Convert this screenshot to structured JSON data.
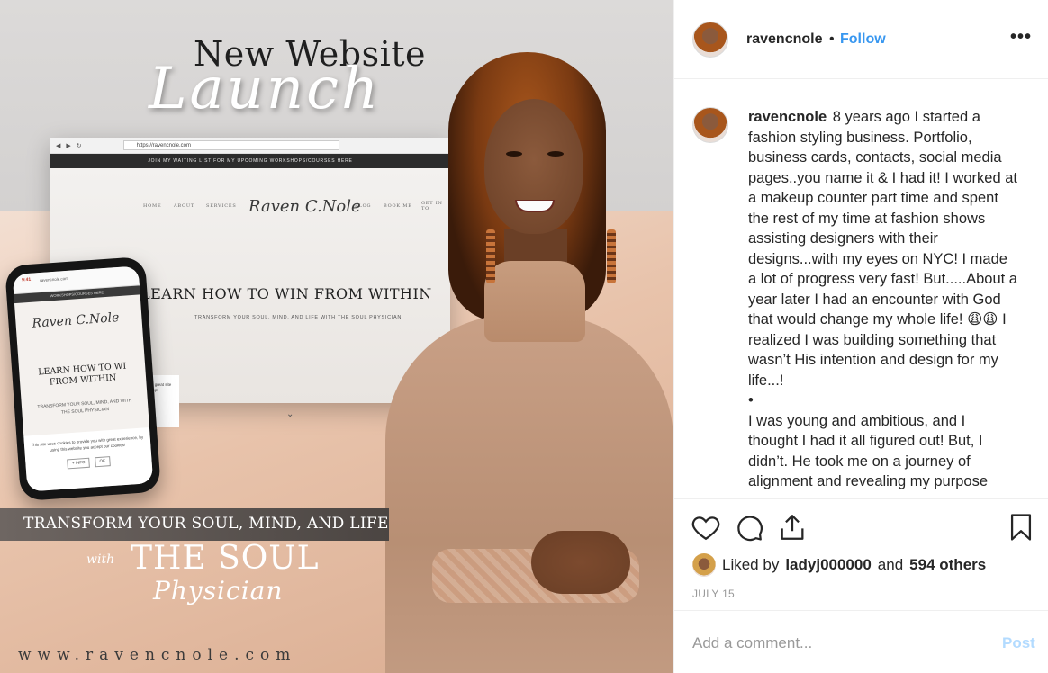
{
  "image": {
    "headline": "New Website",
    "script_word": "Launch",
    "browser": {
      "url": "https://ravencnole.com",
      "banner": "JOIN MY WAITING LIST FOR MY UPCOMING WORKSHOPS/COURSES HERE",
      "nav": [
        "HOME",
        "ABOUT",
        "SERVICES",
        "BLOG",
        "BOOK ME",
        "GET IN TO"
      ],
      "logo": "Raven C.Nole",
      "hero": "LEARN HOW TO WIN FROM WITHIN",
      "sub": "TRANSFORM YOUR SOUL, MIND, AND LIFE WITH THE SOUL PHYSICIAN",
      "cookie": "you with great site you accept",
      "arrow": "⌄"
    },
    "phone": {
      "time": "9:41",
      "url": "ravencnole.com",
      "banner": "WORKSHOPS/COURSES HERE",
      "logo": "Raven C.Nole",
      "hero": "LEARN HOW TO WI FROM WITHIN",
      "sub": "TRANSFORM YOUR SOUL, MIND, AND WITH THE SOUL PHYSICIAN",
      "cookie": "This site uses cookies to provide you with great experience, by using this website you accept our cookies!",
      "btn_info": "+ INFO",
      "btn_ok": "OK"
    },
    "tagline": "TRANSFORM YOUR SOUL, MIND, AND LIFE",
    "with": "with",
    "brand": "THE SOUL",
    "brand_script": "Physician",
    "site_url": "www.ravencnole.com"
  },
  "header": {
    "username": "ravencnole",
    "separator": "•",
    "follow_label": "Follow",
    "more_icon": "more-horizontal-icon",
    "more_glyph": "•••"
  },
  "caption": {
    "username": "ravencnole",
    "paragraph1": "8 years ago I started a fashion styling business. Portfolio, business cards, contacts, social media pages..you name it & I had it! I worked at a makeup counter part time and spent the rest of my time at fashion shows assisting designers with their designs...with my eyes on NYC! I made a lot of progress very fast! But.....About a year later I had an encounter with God that would change my whole life!",
    "emoji": "😩😩",
    "paragraph1_end": "I realized I was building something that wasn’t His intention and design for my life...!",
    "bullet": "•",
    "paragraph2": "I was young and ambitious, and I thought I had it all figured out! But, I didn’t. He took me on a journey of alignment and revealing my purpose"
  },
  "actions": {
    "like_icon": "heart-icon",
    "comment_icon": "comment-icon",
    "share_icon": "share-icon",
    "save_icon": "bookmark-icon"
  },
  "likes": {
    "prefix": "Liked by",
    "user": "ladyj000000",
    "and": "and",
    "others": "594 others"
  },
  "date": "JULY 15",
  "comment": {
    "placeholder": "Add a comment...",
    "post_label": "Post"
  },
  "colors": {
    "link_blue": "#3897f0",
    "post_disabled": "#b3dbff",
    "text": "#262626",
    "muted": "#999999"
  }
}
